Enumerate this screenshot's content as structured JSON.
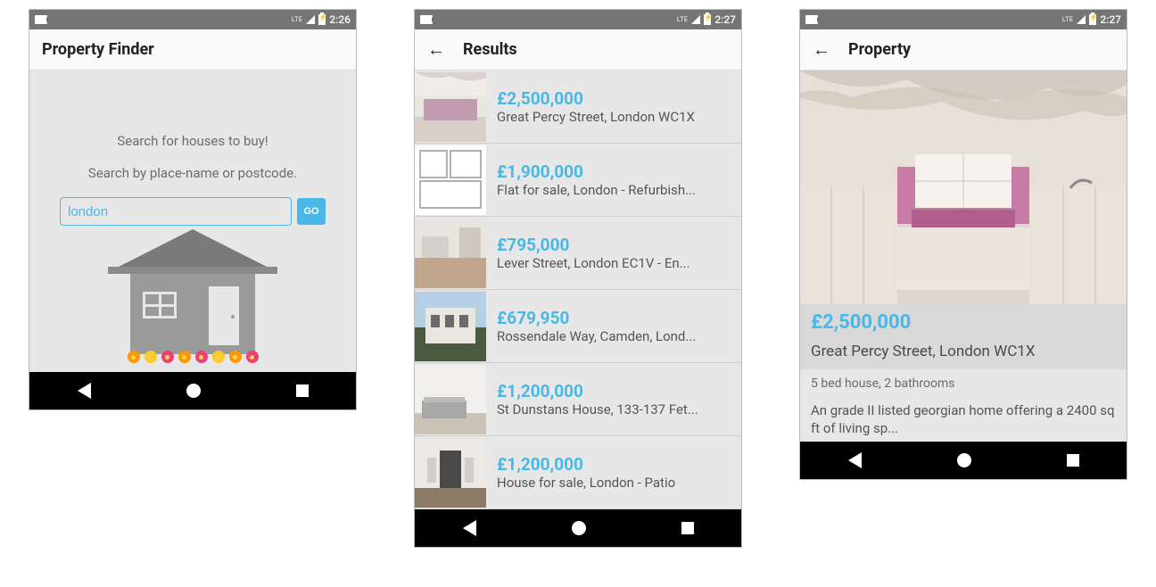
{
  "statusbar": {
    "lte": "LTE",
    "time_1": "2:26",
    "time_2": "2:27",
    "time_3": "2:27"
  },
  "screen1": {
    "title": "Property Finder",
    "tagline": "Search for houses to buy!",
    "hint": "Search by place-name or postcode.",
    "input_value": "london",
    "go_label": "GO"
  },
  "screen2": {
    "title": "Results",
    "items": [
      {
        "price": "£2,500,000",
        "address": "Great Percy Street, London WC1X"
      },
      {
        "price": "£1,900,000",
        "address": "Flat for sale, London - Refurbish..."
      },
      {
        "price": "£795,000",
        "address": "Lever Street, London EC1V - En..."
      },
      {
        "price": "£679,950",
        "address": "Rossendale Way, Camden, Lond..."
      },
      {
        "price": "£1,200,000",
        "address": "St Dunstans House, 133-137 Fet..."
      },
      {
        "price": "£1,200,000",
        "address": "House for sale, London - Patio"
      }
    ]
  },
  "screen3": {
    "title": "Property",
    "price": "£2,500,000",
    "address": "Great Percy Street, London WC1X",
    "meta": "5 bed house, 2 bathrooms",
    "description": "An grade II listed georgian home offering a 2400 sq ft of living sp..."
  },
  "colors": {
    "accent": "#49b8e6"
  }
}
